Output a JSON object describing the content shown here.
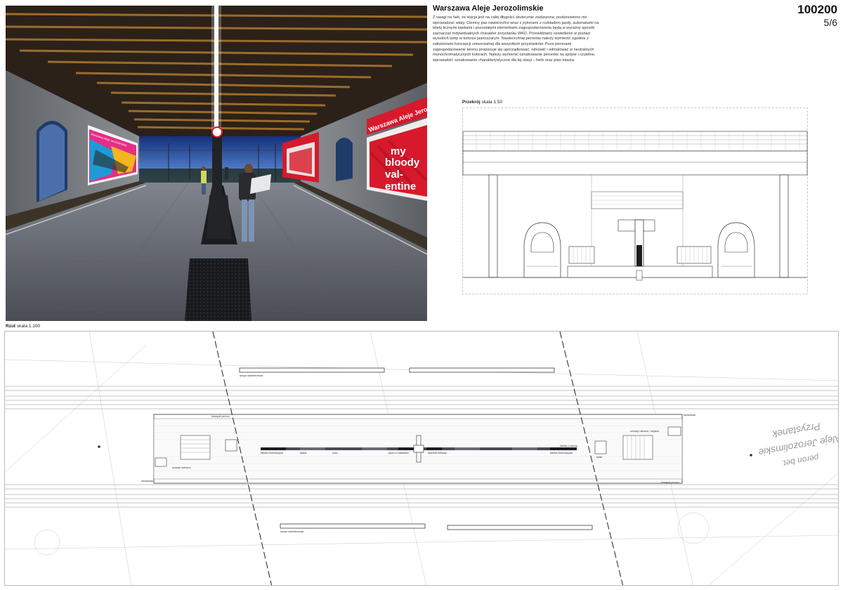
{
  "header": {
    "title": "Warszawa Aleje Jerozolimskie",
    "description": "Z uwagi na fakt, że stacja jest na całej długości skutecznie zadaszona, postanowiono nie wprowadzać wiaty. Ciemny pas nawierzchni wraz z pylonami z rozkładem jazdy, automatami na bilety licznymi ławkami i pozostałymi elementami zagospodarowania będą w wyraźny sposób zaznaczać indywidualnych charakter przystanku WKD. Przewidziano oświetlenie w postaci wysokich lamp w kolorze jasnoszarym. Nawierzchnię peronów należy wymienić zgodnie z założeniami koncepcji uniwersalnej dla wszystkich przystanków. Poza peronami zagospodarowanie terenu proponuje się uporządkować; odnowić i odmalować w neutralnych monochromatycznych kolorach. Należy wymienić oznakowanie peronów na spójne i czytelne, wprowadzić oznakowanie charakterystyczne dla tej stacji – herb oraz plan miasta.",
    "code": "100200",
    "page": "5/6"
  },
  "render": {
    "station_sign": "Warszawa Aleje Jerozolimskie",
    "station_sign_left": "Warszawa Aleje Jerozolimskie",
    "billboard_lines": [
      "my",
      "bloody",
      "val-",
      "entine"
    ]
  },
  "section": {
    "label_bold": "Przekrój",
    "label_scale": "skala 1:50"
  },
  "plan": {
    "label_bold": "Rzut",
    "label_scale": "skala 1:100",
    "annotations": {
      "edge_top": "krawędź peronu",
      "edge_bottom": "krawędź peronu",
      "stairs_top": "schody ruchome / wejście",
      "stairs_bottom": "schody ruchome",
      "bench": "ławka",
      "trash": "kosz",
      "info_left": "tablica informacyjna",
      "info_right": "tablica informacyjna",
      "pylon": "pylon z rozkładem",
      "ticket": "automat biletowy",
      "lamp_top": "lampa oświetleniowa",
      "lamp_bottom": "lampa oświetleniowa",
      "barrier_left": "balustrada",
      "barrier_right": "balustrada",
      "sign": "tablica z nazwą",
      "booth": "kiosk"
    },
    "map_text_1": "Przystanek",
    "map_text_2": "D Aleje Jerozolimskie",
    "map_text_3": "peron bet."
  },
  "colors": {
    "accent_red": "#d8192c",
    "sky_blue": "#2c5aa8",
    "ceiling_wood": "#8a5a22",
    "platform_grey": "#6c7078",
    "dark_strip": "#1b1c20"
  }
}
